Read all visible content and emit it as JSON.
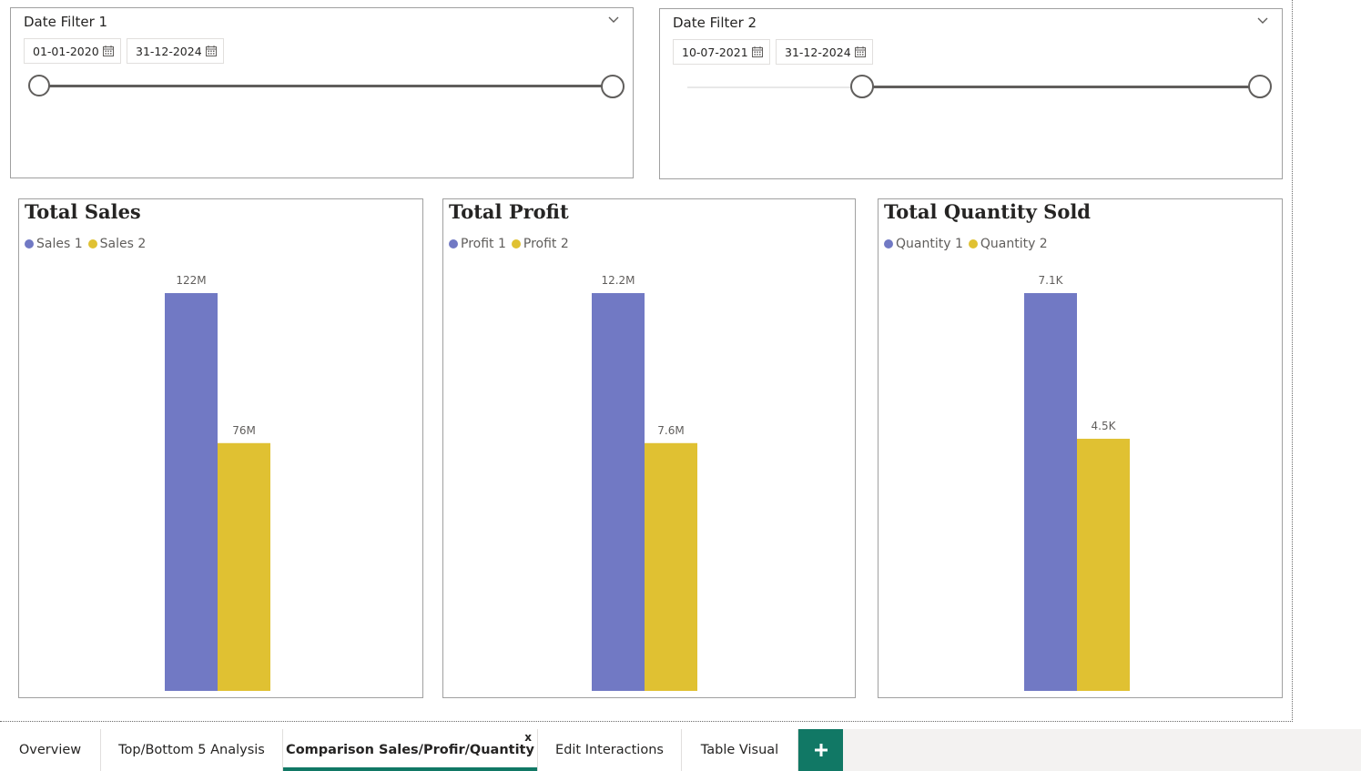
{
  "slicers": [
    {
      "title": "Date Filter 1",
      "start": "01-01-2020",
      "end": "31-12-2024"
    },
    {
      "title": "Date Filter 2",
      "start": "10-07-2021",
      "end": "31-12-2024"
    }
  ],
  "colors": {
    "series1": "#7179C4",
    "series2": "#E0C132",
    "accent": "#117865"
  },
  "chart_data": [
    {
      "type": "bar",
      "title": "Total Sales",
      "series": [
        {
          "name": "Sales 1",
          "value": 122,
          "label": "122M"
        },
        {
          "name": "Sales 2",
          "value": 76,
          "label": "76M"
        }
      ],
      "ylim": [
        0,
        122
      ]
    },
    {
      "type": "bar",
      "title": "Total Profit",
      "series": [
        {
          "name": "Profit 1",
          "value": 12.2,
          "label": "12.2M"
        },
        {
          "name": "Profit 2",
          "value": 7.6,
          "label": "7.6M"
        }
      ],
      "ylim": [
        0,
        12.2
      ]
    },
    {
      "type": "bar",
      "title": "Total Quantity Sold",
      "series": [
        {
          "name": "Quantity 1",
          "value": 7.1,
          "label": "7.1K"
        },
        {
          "name": "Quantity 2",
          "value": 4.5,
          "label": "4.5K"
        }
      ],
      "ylim": [
        0,
        7.1
      ]
    }
  ],
  "tabs": [
    {
      "label": "Overview"
    },
    {
      "label": "Top/Bottom 5 Analysis"
    },
    {
      "label": "Comparison Sales/Profir/Quantity",
      "close": "x"
    },
    {
      "label": "Edit Interactions"
    },
    {
      "label": "Table Visual"
    }
  ],
  "add_tab_label": "+"
}
